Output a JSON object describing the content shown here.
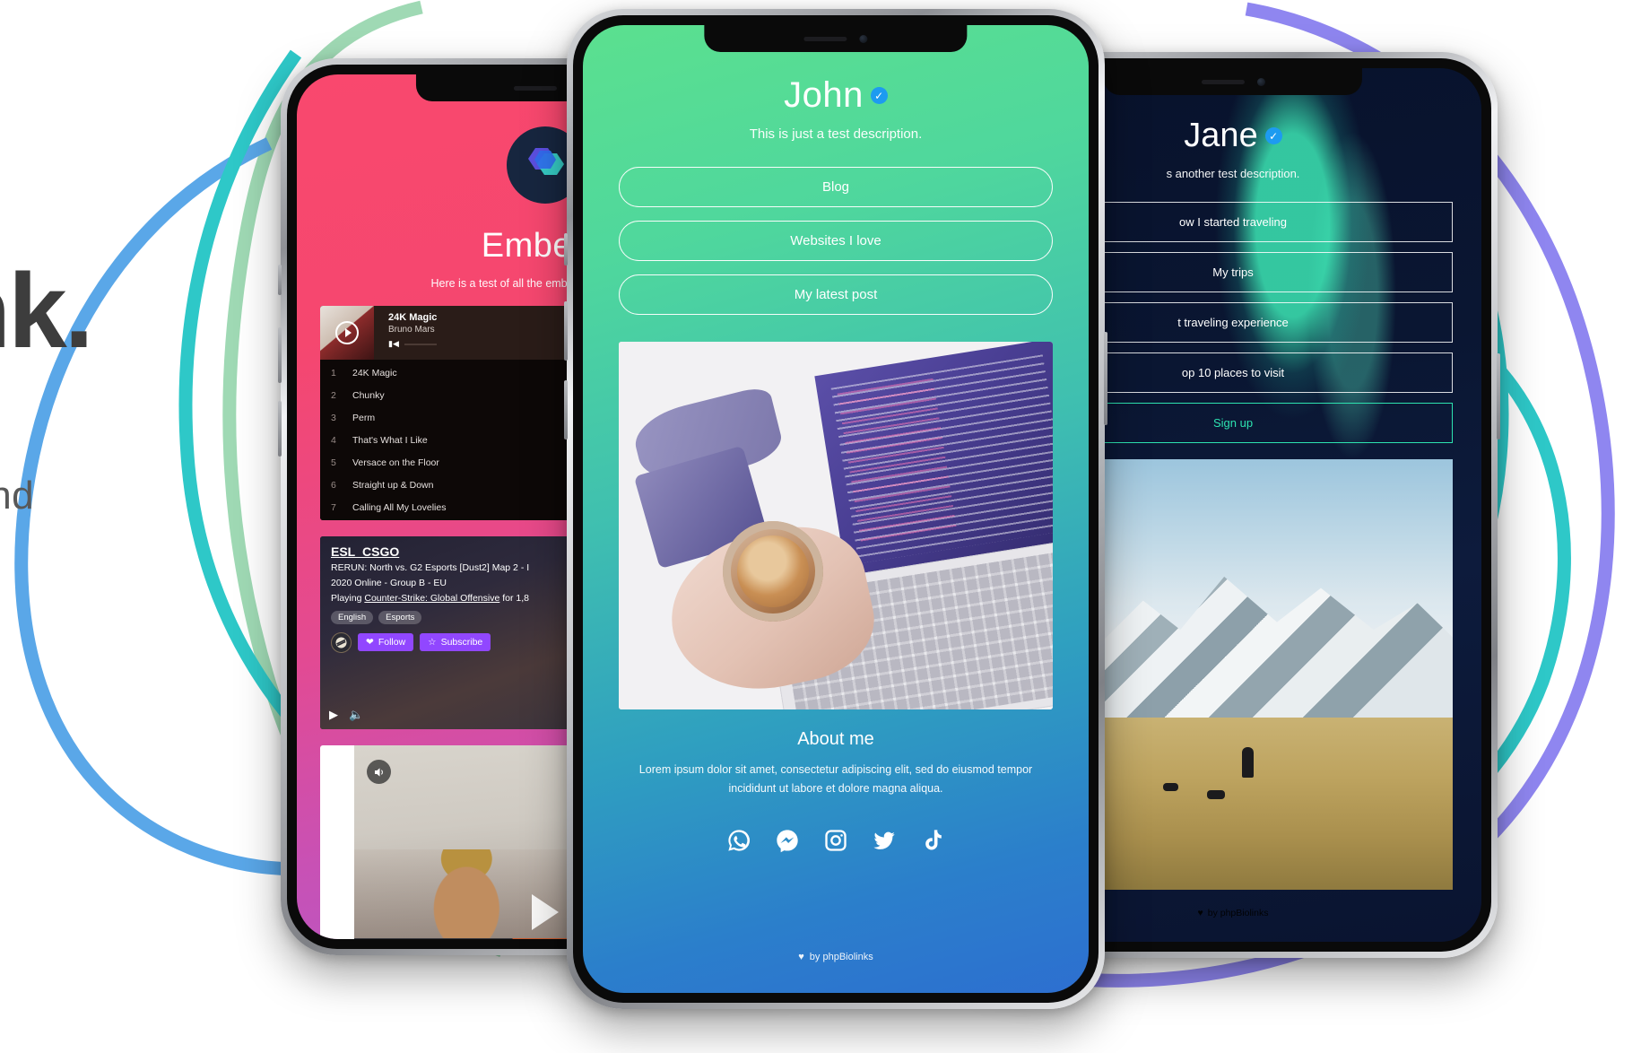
{
  "hero": {
    "headline_fragment": "nk.",
    "subline_fragment": "s and"
  },
  "center_phone": {
    "profile_name": "John",
    "verified_icon": "verified-badge-icon",
    "description": "This is just a test description.",
    "buttons": [
      {
        "label": "Blog"
      },
      {
        "label": "Websites I love"
      },
      {
        "label": "My latest post"
      }
    ],
    "image_alt": "laptop-coffee-photo",
    "about_heading": "About me",
    "about_text": "Lorem ipsum dolor sit amet, consectetur adipiscing elit, sed do eiusmod tempor incididunt ut labore et dolore magna aliqua.",
    "socials": [
      {
        "name": "whatsapp-icon"
      },
      {
        "name": "messenger-icon"
      },
      {
        "name": "instagram-icon"
      },
      {
        "name": "twitter-icon"
      },
      {
        "name": "tiktok-icon"
      }
    ],
    "footer": "by phpBiolinks",
    "colors": {
      "gradient_start": "#5be08f",
      "gradient_end": "#2d6fd0",
      "verified": "#1d9bf0"
    }
  },
  "left_phone": {
    "title": "Embeds",
    "subtitle": "Here is a test of all the embeds that can be ad",
    "avatar_icon": "hexagon-logo-icon",
    "spotify": {
      "track_title": "24K Magic",
      "artist": "Bruno Mars",
      "tracks": [
        {
          "n": "1",
          "title": "24K Magic"
        },
        {
          "n": "2",
          "title": "Chunky"
        },
        {
          "n": "3",
          "title": "Perm"
        },
        {
          "n": "4",
          "title": "That's What I Like"
        },
        {
          "n": "5",
          "title": "Versace on the Floor"
        },
        {
          "n": "6",
          "title": "Straight up & Down"
        },
        {
          "n": "7",
          "title": "Calling All My Lovelies"
        }
      ]
    },
    "twitch": {
      "channel": "ESL_CSGO",
      "line1": "RERUN: North vs. G2 Esports [Dust2] Map 2 - I",
      "line2": "2020 Online - Group B - EU",
      "line3_prefix": "Playing ",
      "line3_link": "Counter-Strike: Global Offensive",
      "line3_suffix": " for 1,8",
      "tags": [
        "English",
        "Esports"
      ],
      "follow_label": "Follow",
      "subscribe_label": "Subscribe"
    },
    "tiktok": {
      "alt": "tiktok-video-embed"
    },
    "colors": {
      "gradient_start": "#f9486e",
      "gradient_end": "#b658c6"
    }
  },
  "right_phone": {
    "profile_name": "Jane",
    "verified_icon": "verified-badge-icon",
    "description": "s another test description.",
    "buttons": [
      {
        "label": "ow I started traveling"
      },
      {
        "label": "My trips"
      },
      {
        "label": "t traveling experience"
      },
      {
        "label": "op 10 places to visit"
      },
      {
        "label": "Sign up",
        "accent": true
      }
    ],
    "image_alt": "mountain-hiker-photo",
    "footer": "by phpBiolinks",
    "colors": {
      "background": "#060a1c",
      "accent": "#2de3b0"
    }
  },
  "decoration": {
    "blobs": [
      {
        "name": "green-blob",
        "color": "#9fd9b4"
      },
      {
        "name": "blue-blob",
        "color": "#5aa7e8"
      },
      {
        "name": "teal-blob",
        "color": "#2ec8c8"
      },
      {
        "name": "purple-blob",
        "color": "#8f86f0"
      }
    ]
  }
}
